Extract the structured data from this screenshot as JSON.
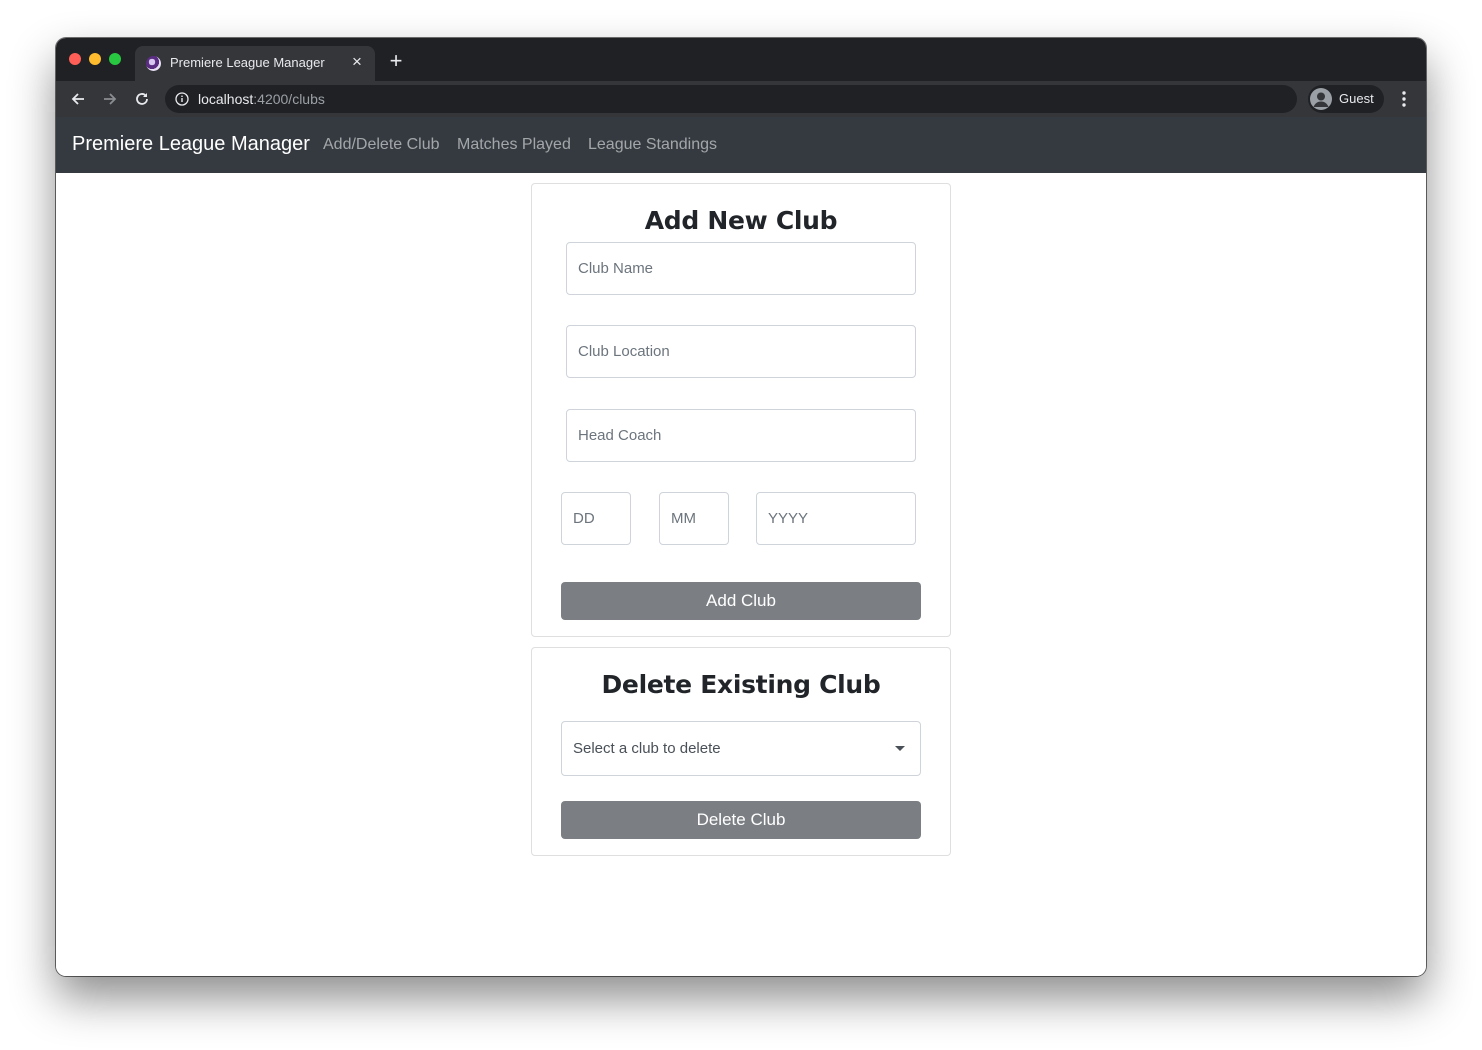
{
  "browser": {
    "tab_title": "Premiere League Manager",
    "new_tab_symbol": "+",
    "close_symbol": "×",
    "url_host": "localhost",
    "url_path": ":4200/clubs",
    "profile_name": "Guest",
    "icons": [
      "back-icon",
      "forward-icon",
      "reload-icon",
      "info-icon",
      "avatar-icon",
      "menu-dots-icon"
    ]
  },
  "navbar": {
    "brand": "Premiere League Manager",
    "links": [
      {
        "label": "Add/Delete Club"
      },
      {
        "label": "Matches Played"
      },
      {
        "label": "League Standings"
      }
    ],
    "background_color": "#343a40"
  },
  "add_club": {
    "title": "Add New Club",
    "club_name_placeholder": "Club Name",
    "club_location_placeholder": "Club Location",
    "head_coach_placeholder": "Head Coach",
    "day_placeholder": "DD",
    "month_placeholder": "MM",
    "year_placeholder": "YYYY",
    "submit_label": "Add Club"
  },
  "delete_club": {
    "title": "Delete Existing Club",
    "select_value": "Select a club to delete",
    "submit_label": "Delete Club"
  },
  "colors": {
    "button": "#7b7f83",
    "tabstrip": "#202124",
    "toolbar": "#35363a"
  }
}
